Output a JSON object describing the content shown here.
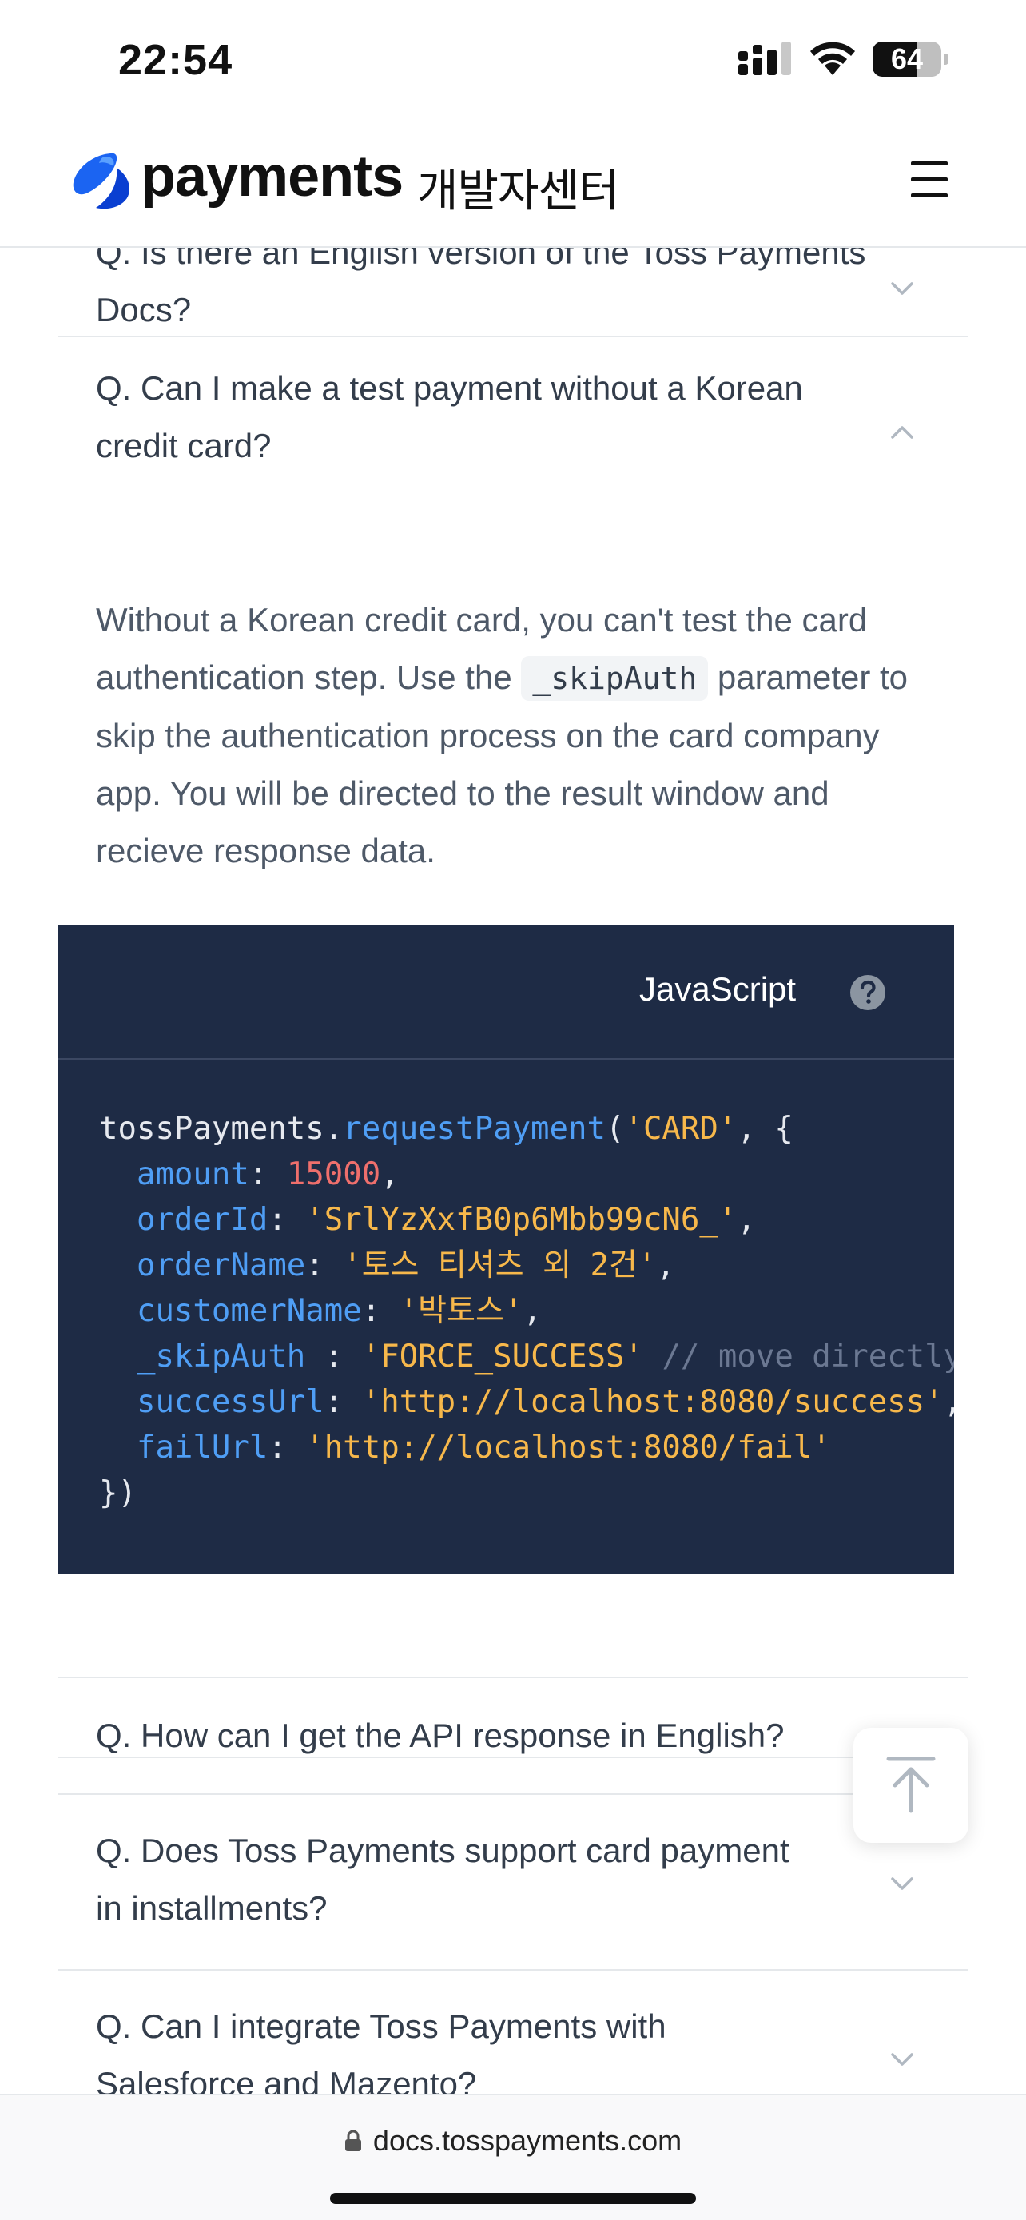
{
  "status_bar": {
    "time": "22:54",
    "battery": "64",
    "battery_level": 0.64,
    "icons": [
      "cellular-signal-icon",
      "wifi-icon",
      "battery-icon"
    ]
  },
  "header": {
    "logo_word": "payments",
    "logo_sub": "개발자센터",
    "menu_icon": "hamburger-menu-icon"
  },
  "faq": {
    "items": [
      {
        "question": "Q. Is there an English version of the Toss Payments Docs?",
        "expanded": false
      },
      {
        "question": "Q. Can I make a test payment without a Korean credit card?",
        "expanded": true
      },
      {
        "question": "Q. How can I get the API response in English?",
        "expanded": false
      },
      {
        "question": "Q. Does Toss Payments support card payment in installments?",
        "expanded": false
      },
      {
        "question": "Q. Can I integrate Toss Payments with Salesforce and Mazento?",
        "expanded": false
      }
    ],
    "answer": {
      "part1": "Without a Korean credit card, you can't test the card authentication step. Use the ",
      "inline_code": "_skipAuth",
      "part2": " parameter to skip the authentication process on the card company app. You will be directed to the result window and recieve response data."
    }
  },
  "code_block": {
    "language": "JavaScript",
    "help_icon": "question-circle-icon",
    "tokens": {
      "obj": "tossPayments",
      "dot": ".",
      "method": "requestPayment",
      "open": "(",
      "card": "'CARD'",
      "comma_brace": ", {",
      "k_amount": "amount",
      "v_amount": "15000",
      "k_orderId": "orderId",
      "v_orderId": "'SrlYzXxfB0p6Mbb99cN6_'",
      "k_orderName": "orderName",
      "v_orderName": "'토스 티셔츠 외 2건'",
      "k_customerName": "customerName",
      "v_customerName": "'박토스'",
      "k_skipAuth": "_skipAuth",
      "v_skipAuth": "'FORCE_SUCCESS'",
      "comment": "// move directly to successUrl",
      "k_successUrl": "successUrl",
      "v_successUrl": "'http://localhost:8080/success'",
      "k_failUrl": "failUrl",
      "v_failUrl": "'http://localhost:8080/fail'",
      "close": "})"
    }
  },
  "scroll_top_icon": "arrow-up-to-top-icon",
  "browser": {
    "url": "docs.tosspayments.com",
    "lock_icon": "lock-icon"
  },
  "colors": {
    "code_bg": "#1e2b45",
    "code_key": "#4f9ef5",
    "code_string": "#f7b84b",
    "code_number": "#ef6f6c",
    "brand_blue": "#0064ff"
  }
}
